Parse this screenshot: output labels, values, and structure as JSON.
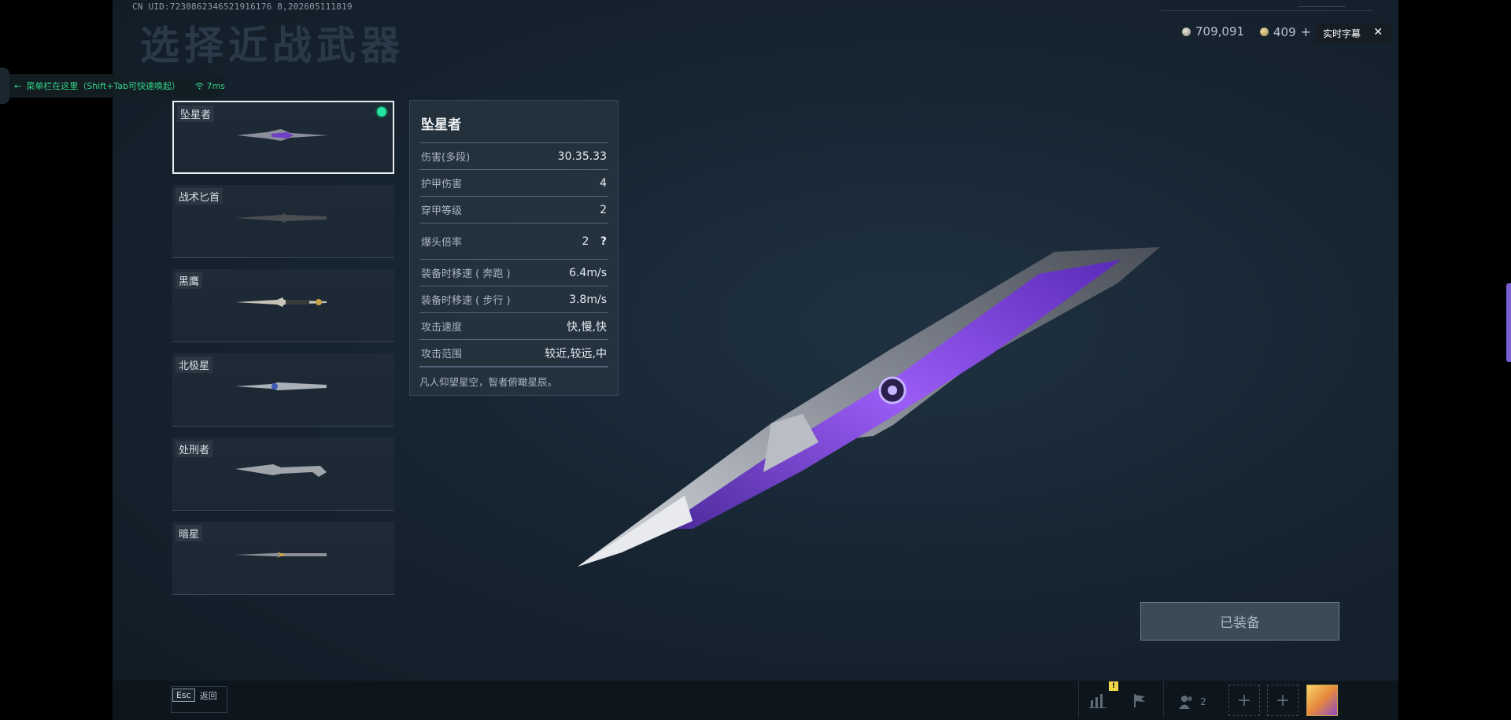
{
  "uid_text": "CN UID:7230862346521916176 8,202605111819",
  "page_title": "选择近战武器",
  "overlay": {
    "menu_hint": "菜单栏在这里（Shift+Tab可快速唤起）",
    "ping": "7ms"
  },
  "currency": {
    "silver": "709,091",
    "gold": "409"
  },
  "caption_button": "实时字幕",
  "weapons": [
    {
      "name": "坠星者",
      "selected": true
    },
    {
      "name": "战术匕首",
      "selected": false
    },
    {
      "name": "黑鹰",
      "selected": false
    },
    {
      "name": "北极星",
      "selected": false
    },
    {
      "name": "处刑者",
      "selected": false
    },
    {
      "name": "暗星",
      "selected": false
    }
  ],
  "stats": {
    "title": "坠星者",
    "rows": [
      {
        "label": "伤害(多段)",
        "value": "30.35.33"
      },
      {
        "label": "护甲伤害",
        "value": "4"
      },
      {
        "label": "穿甲等级",
        "value": "2"
      },
      {
        "label": "爆头倍率",
        "value": "2"
      },
      {
        "label": "装备时移速 ( 奔跑 )",
        "value": "6.4m/s"
      },
      {
        "label": "装备时移速 ( 步行 )",
        "value": "3.8m/s"
      },
      {
        "label": "攻击速度",
        "value": "快,慢,快"
      },
      {
        "label": "攻击范围",
        "value": "较近,较远,中"
      }
    ],
    "help_mark": "?",
    "description": "凡人仰望星空，智者俯瞰星辰。"
  },
  "equip_button": "已装备",
  "bottom": {
    "esc_key": "Esc",
    "back_label": "返回",
    "notification_count": "!",
    "friends_count": "2",
    "add_icon": "+"
  },
  "colors": {
    "accent_green": "#25e3a0",
    "overlay_green": "#35d58a",
    "weapon_purple": "#7b3fd6"
  }
}
